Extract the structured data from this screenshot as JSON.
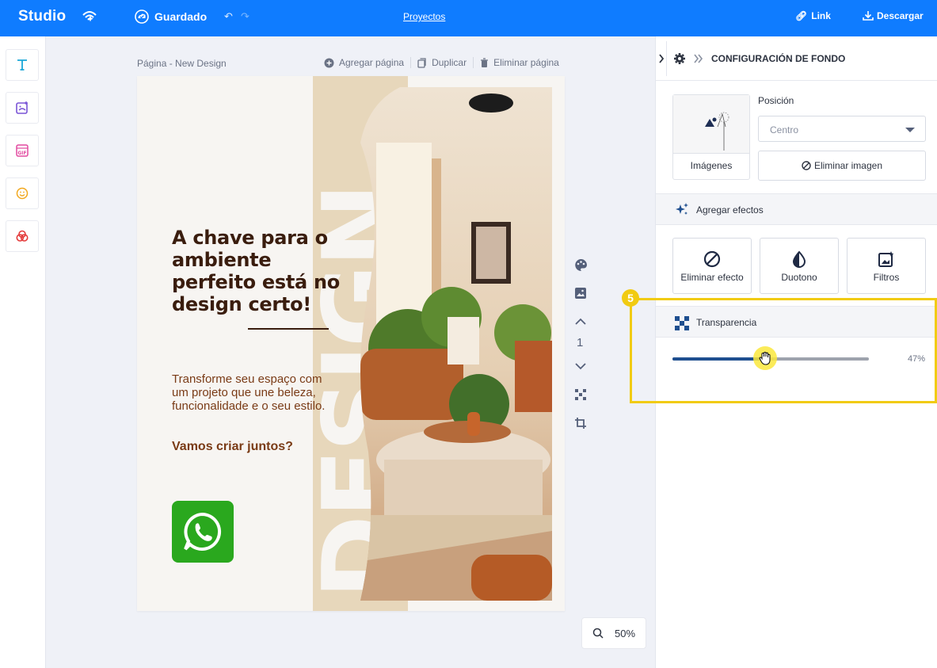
{
  "topbar": {
    "brand": "Studio",
    "brand_icon": "wifi-sparkle-icon",
    "saved_label": "Guardado",
    "undo_icon": "undo-icon",
    "redo_icon": "redo-icon",
    "projects_label": "Proyectos",
    "link_label": "Link",
    "download_label": "Descargar",
    "bar_color": "#0f7cff"
  },
  "rail": {
    "items": [
      {
        "name": "text-tool",
        "icon": "text-icon",
        "color": "#1aa7d8"
      },
      {
        "name": "image-tool",
        "icon": "image-add-icon",
        "color": "#7a54d6"
      },
      {
        "name": "gif-tool",
        "icon": "gif-icon",
        "color": "#e24aa0"
      },
      {
        "name": "emoji-tool",
        "icon": "smiley-icon",
        "color": "#f2a81d"
      },
      {
        "name": "shapes-tool",
        "icon": "circles-icon",
        "color": "#e43a3a"
      }
    ]
  },
  "canvas": {
    "page_label": "Página - New Design",
    "add_page": "Agregar página",
    "duplicate": "Duplicar",
    "delete_page": "Eliminar página",
    "page_number": "1",
    "zoom": "50%"
  },
  "design": {
    "headline": "A chave para o ambiente perfeito está no design certo!",
    "body": "Transforme seu espaço com um projeto que une beleza, funcionalidade e o seu estilo.",
    "cta": "Vamos criar juntos?",
    "logo": "whatsapp-logo",
    "bg_word": "DESIGN"
  },
  "panel": {
    "title": "CONFIGURACIÓN DE FONDO",
    "images_label": "Imágenes",
    "position_label": "Posición",
    "position_value": "Centro",
    "remove_image": "Eliminar imagen",
    "effects_header": "Agregar efectos",
    "effects": [
      {
        "label": "Eliminar efecto",
        "icon": "no-entry-icon"
      },
      {
        "label": "Duotono",
        "icon": "half-drop-icon"
      },
      {
        "label": "Filtros",
        "icon": "image-sparkle-icon"
      }
    ],
    "transparency_header": "Transparencia",
    "transparency_value": "47%",
    "transparency_fraction": 0.47
  },
  "annotation": {
    "step": "5",
    "color": "#f1cb12"
  }
}
